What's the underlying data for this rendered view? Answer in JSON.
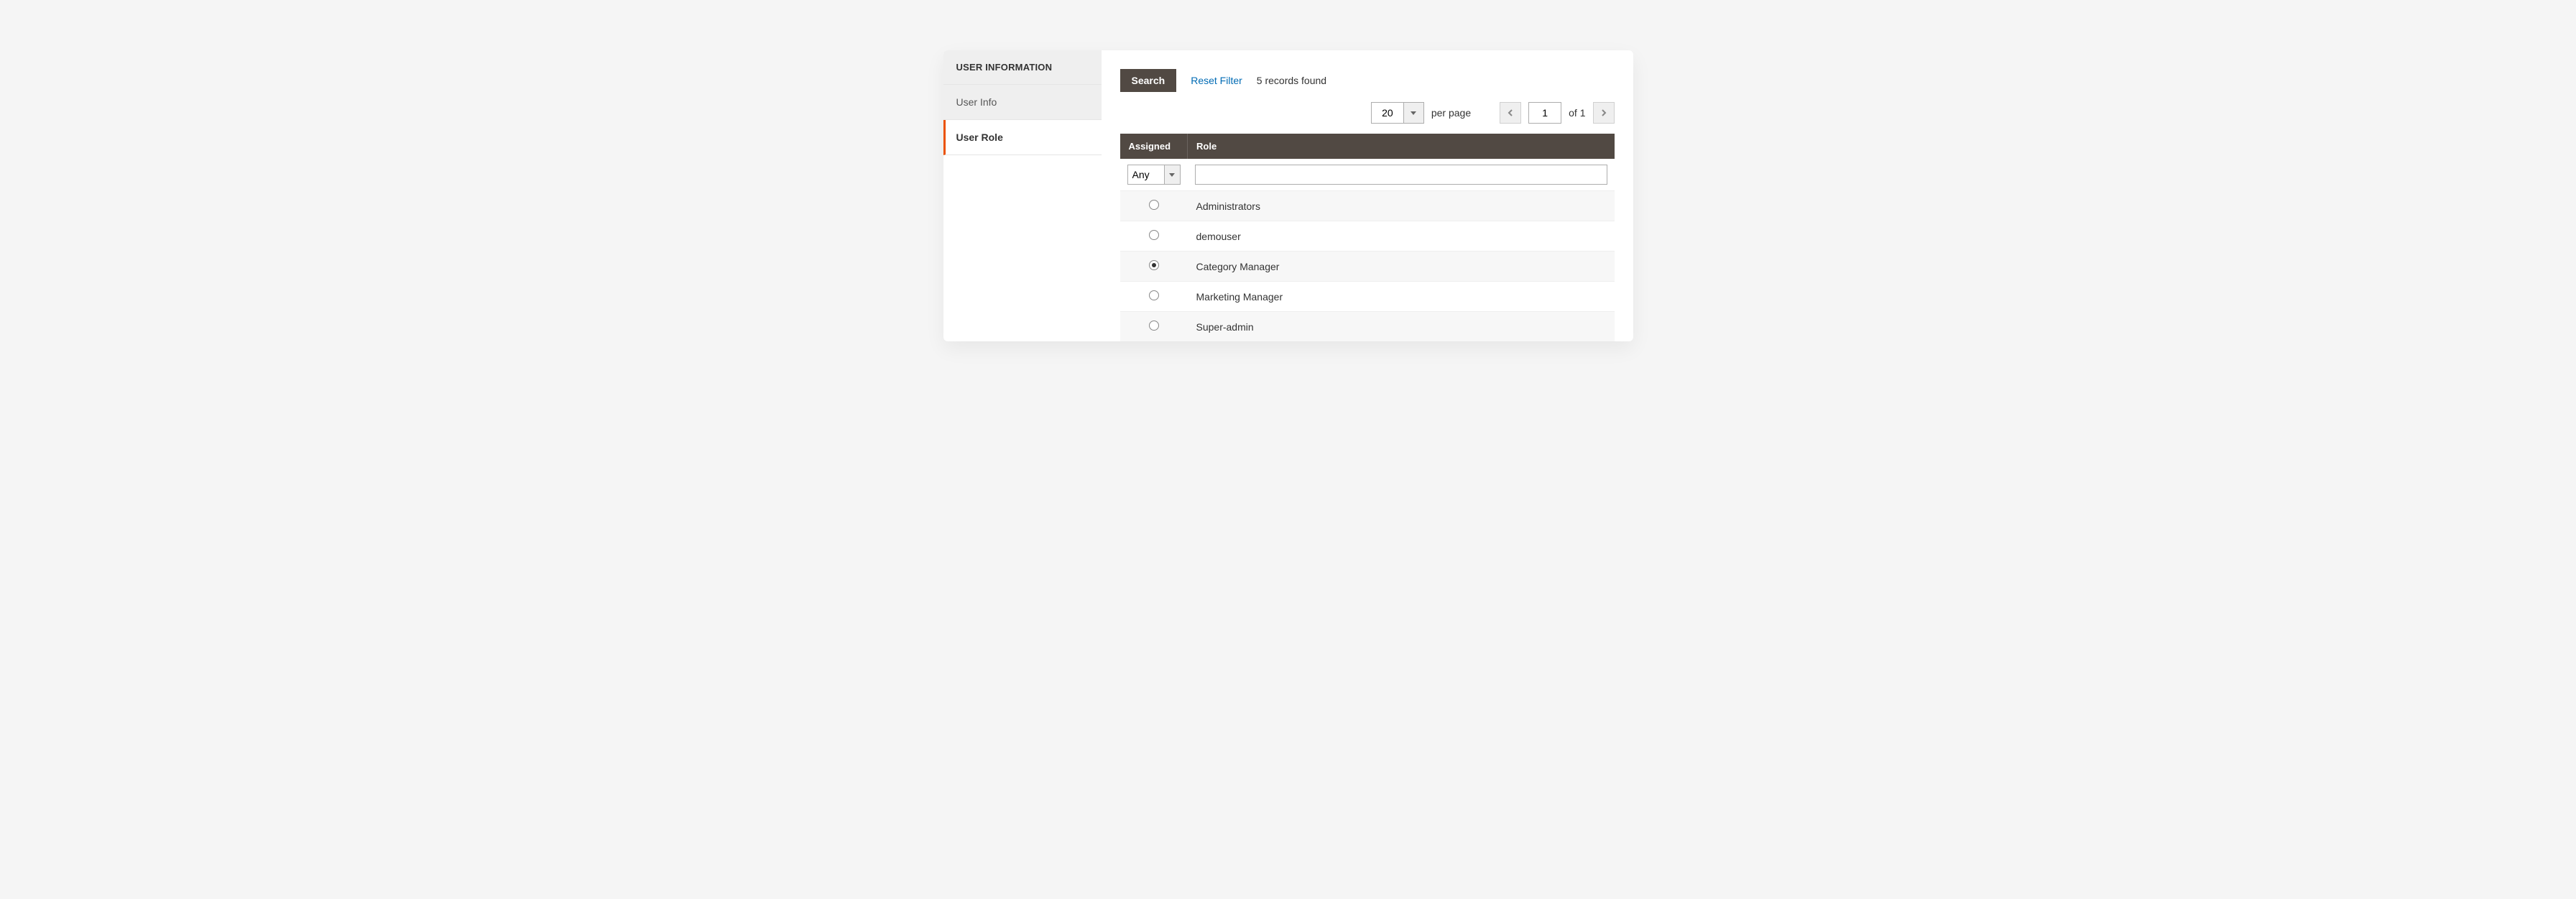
{
  "sidebar": {
    "header": "USER INFORMATION",
    "items": [
      {
        "label": "User Info",
        "active": false
      },
      {
        "label": "User Role",
        "active": true
      }
    ]
  },
  "toolbar": {
    "search_label": "Search",
    "reset_label": "Reset Filter",
    "records_found": "5 records found"
  },
  "pager": {
    "page_size": "20",
    "per_page_label": "per page",
    "current_page": "1",
    "of_label": "of 1"
  },
  "table": {
    "headers": {
      "assigned": "Assigned",
      "role": "Role"
    },
    "filters": {
      "assigned_value": "Any",
      "role_value": ""
    },
    "rows": [
      {
        "role": "Administrators",
        "selected": false
      },
      {
        "role": "demouser",
        "selected": false
      },
      {
        "role": "Category Manager",
        "selected": true
      },
      {
        "role": "Marketing Manager",
        "selected": false
      },
      {
        "role": "Super-admin",
        "selected": false
      }
    ]
  }
}
